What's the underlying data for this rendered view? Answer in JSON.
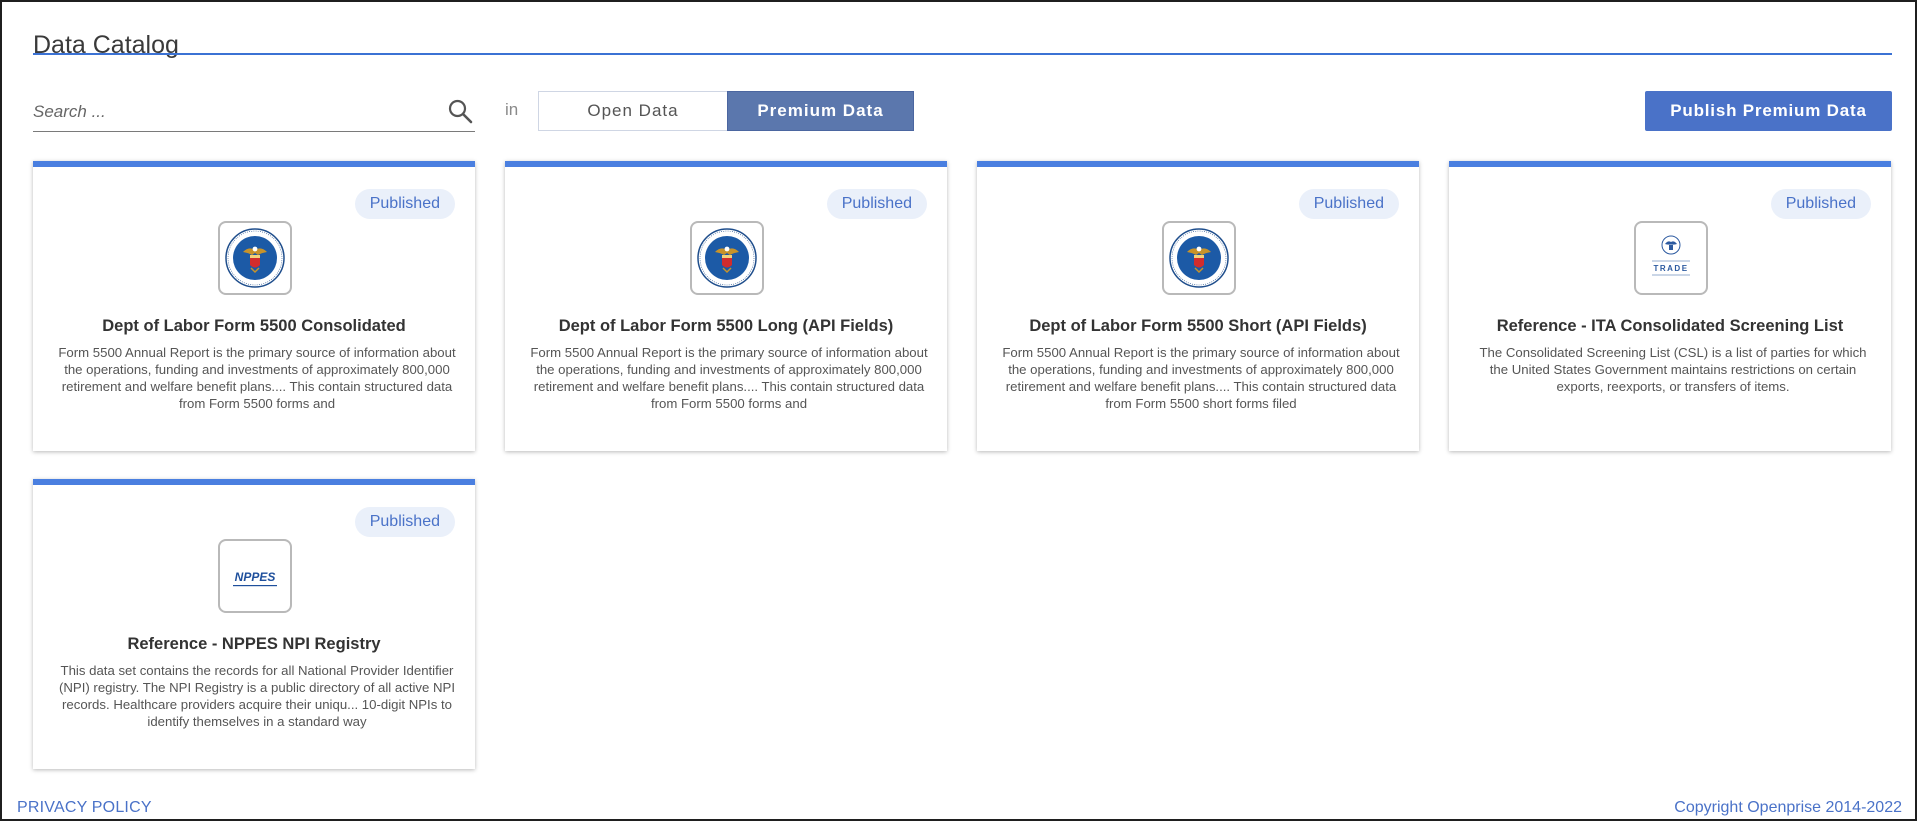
{
  "page": {
    "title": "Data Catalog"
  },
  "search": {
    "placeholder": "Search ...",
    "value": "",
    "in_label": "in"
  },
  "toggle": {
    "open_label": "Open Data",
    "premium_label": "Premium Data",
    "selected": "Premium Data"
  },
  "actions": {
    "publish_label": "Publish Premium Data"
  },
  "colors": {
    "accent": "#4a72c8",
    "card_top": "#4a7fe0",
    "toggle_selected": "#5b77ad",
    "badge_bg": "#eaf0fa"
  },
  "cards": [
    {
      "status": "Published",
      "logo": "dol-seal-icon",
      "title": "Dept of Labor Form 5500 Consolidated",
      "description": "Form 5500 Annual Report is the primary source of information about the operations, funding and investments of approximately 800,000 retirement and welfare benefit plans.... This contain structured data from Form 5500 forms and"
    },
    {
      "status": "Published",
      "logo": "dol-seal-icon",
      "title": "Dept of Labor Form 5500 Long (API Fields)",
      "description": "Form 5500 Annual Report is the primary source of information about the operations, funding and investments of approximately 800,000 retirement and welfare benefit plans.... This contain structured data from Form 5500 forms and"
    },
    {
      "status": "Published",
      "logo": "dol-seal-icon",
      "title": "Dept of Labor Form 5500 Short (API Fields)",
      "description": "Form 5500 Annual Report is the primary source of information about the operations, funding and investments of approximately 800,000 retirement and welfare benefit plans.... This contain structured data from Form 5500 short forms filed"
    },
    {
      "status": "Published",
      "logo": "ita-trade-logo-icon",
      "logo_text": "TRADE",
      "title": "Reference - ITA Consolidated Screening List",
      "description": "The Consolidated Screening List (CSL) is a list of parties for which the United States Government maintains restrictions on certain exports, reexports, or transfers of items."
    },
    {
      "status": "Published",
      "logo": "nppes-logo-icon",
      "logo_text": "NPPES",
      "title": "Reference - NPPES NPI Registry",
      "description": "This data set contains the records for all National Provider Identifier (NPI) registry. The NPI Registry is a public directory of all active NPI records. Healthcare providers acquire their uniqu... 10-digit NPIs to identify themselves in a standard way"
    }
  ],
  "footer": {
    "privacy": "PRIVACY POLICY",
    "copyright": "Copyright Openprise 2014-2022"
  }
}
